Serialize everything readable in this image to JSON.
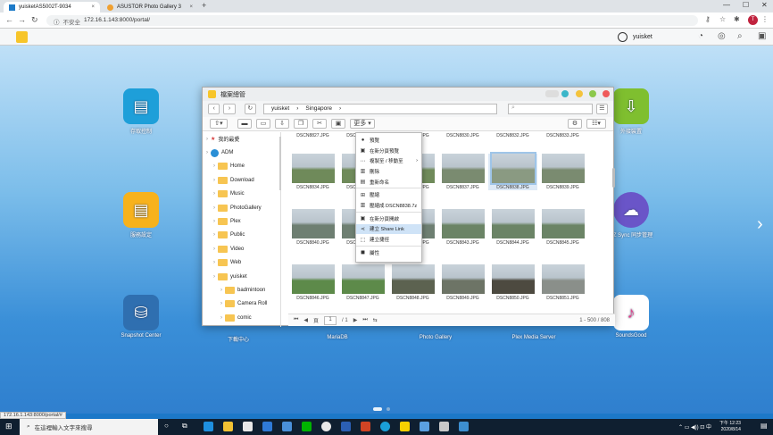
{
  "browser": {
    "tabs": [
      {
        "label": "yuisketAS5002T-9034",
        "close": "×"
      },
      {
        "label": "ASUSTOR Photo Gallery 3",
        "close": "×"
      }
    ],
    "new_tab": "+",
    "win_min": "—",
    "win_max": "☐",
    "win_close": "✕",
    "insecure": "不安全",
    "url": "172.16.1.143:8000/portal/",
    "status_url": "172.16.1.143:8000/portal/#"
  },
  "adm": {
    "user": "yuisket"
  },
  "desktop": {
    "icons": [
      {
        "label": "存取控制",
        "color": "#1e9fd9",
        "glyph": "▤"
      },
      {
        "label": "服務設定",
        "color": "#f7b21c",
        "glyph": "▤"
      },
      {
        "label": "Snapshot Center",
        "color": "#2f6fb0",
        "glyph": "⛁"
      },
      {
        "label": "外接裝置",
        "color": "#7fbf2f",
        "glyph": "⇩"
      },
      {
        "label": "EZ Sync 同步管理",
        "color": "#6a55c8",
        "glyph": "☁"
      },
      {
        "label": "SoundsGood",
        "color": "#e5418a",
        "glyph": "♪"
      }
    ],
    "hidden_labels": [
      "下載中心",
      "MariaDB",
      "Photo Gallery",
      "Plex Media Server"
    ]
  },
  "filewin": {
    "title": "檔案總管",
    "path": [
      "yuisket",
      "Singapore"
    ],
    "search_placeholder": "",
    "more_label": "更多",
    "tree": [
      {
        "label": "我的最愛",
        "lvl": 0,
        "star": true
      },
      {
        "label": "ADM",
        "lvl": 0
      },
      {
        "label": "Home",
        "lvl": 1
      },
      {
        "label": "Download",
        "lvl": 1
      },
      {
        "label": "Music",
        "lvl": 1
      },
      {
        "label": "PhotoGallery",
        "lvl": 1
      },
      {
        "label": "Plex",
        "lvl": 1
      },
      {
        "label": "Public",
        "lvl": 1
      },
      {
        "label": "Video",
        "lvl": 1
      },
      {
        "label": "Web",
        "lvl": 1
      },
      {
        "label": "yuisket",
        "lvl": 1
      },
      {
        "label": "badmintoon",
        "lvl": 2
      },
      {
        "label": "Camera Roll",
        "lvl": 2
      },
      {
        "label": "comic",
        "lvl": 2
      }
    ],
    "thumbs": [
      {
        "name": "DSCN8827.JPG",
        "c": "#7d8a78"
      },
      {
        "name": "DSCN8828.JPG",
        "c": "#7d8a78"
      },
      {
        "name": "DSCN8829.JPG",
        "c": "#7d8a78"
      },
      {
        "name": "DSCN8830.JPG",
        "c": "#7d8a78"
      },
      {
        "name": "DSCN8832.JPG",
        "c": "#7d8a78"
      },
      {
        "name": "DSCN8833.JPG",
        "c": "#7d8a78"
      },
      {
        "name": "DSCN8834.JPG",
        "c": "#6f8a5a"
      },
      {
        "name": "DSCN8835.JPG",
        "c": "#6f8a5a"
      },
      {
        "name": "DSCN8836.JPG",
        "c": "#6f8a5a"
      },
      {
        "name": "DSCN8837.JPG",
        "c": "#7a8b70"
      },
      {
        "name": "DSCN8838.JPG",
        "c": "#8a9a82",
        "sel": true
      },
      {
        "name": "DSCN8839.JPG",
        "c": "#7a8b70"
      },
      {
        "name": "DSCN8840.JPG",
        "c": "#6e7f72"
      },
      {
        "name": "DSCN8841.JPG",
        "c": "#6e7f72"
      },
      {
        "name": "DSCN8842.JPG",
        "c": "#6e7f72"
      },
      {
        "name": "DSCN8843.JPG",
        "c": "#6b8466"
      },
      {
        "name": "DSCN8844.JPG",
        "c": "#6b8466"
      },
      {
        "name": "DSCN8845.JPG",
        "c": "#6b8466"
      },
      {
        "name": "DSCN8846.JPG",
        "c": "#5d8a4a"
      },
      {
        "name": "DSCN8847.JPG",
        "c": "#5d8a4a"
      },
      {
        "name": "DSCN8848.JPG",
        "c": "#5c6250"
      },
      {
        "name": "DSCN8849.JPG",
        "c": "#6d7466"
      },
      {
        "name": "DSCN8850.JPG",
        "c": "#4d4a40"
      },
      {
        "name": "DSCN8851.JPG",
        "c": "#8a8f8a"
      }
    ],
    "pager": {
      "page": "1",
      "of": "/ 1",
      "range": "1 - 500 / 808"
    },
    "context_menu": [
      {
        "label": "預覽",
        "ic": "●"
      },
      {
        "label": "在新分頁預覽",
        "ic": "▣"
      },
      {
        "label": "複製至 / 移動至",
        "ic": "⋯",
        "arrow": "›"
      },
      {
        "label": "刪除",
        "ic": "▥"
      },
      {
        "label": "重新命名",
        "ic": "▤"
      },
      {
        "sep": true
      },
      {
        "label": "壓縮",
        "ic": "⊞"
      },
      {
        "label": "壓縮成 DSCN8838.7z",
        "ic": "▥"
      },
      {
        "sep": true
      },
      {
        "label": "在新分頁開啟",
        "ic": "▣"
      },
      {
        "label": "建立 Share Link",
        "ic": "⋖",
        "hl": true
      },
      {
        "label": "建立捷徑",
        "ic": "⬚"
      },
      {
        "sep": true
      },
      {
        "label": "屬性",
        "ic": "◼"
      }
    ]
  },
  "taskbar": {
    "search": "在這裡輸入文字來搜尋",
    "time": "下午 12:23",
    "date": "2020/8/14"
  }
}
